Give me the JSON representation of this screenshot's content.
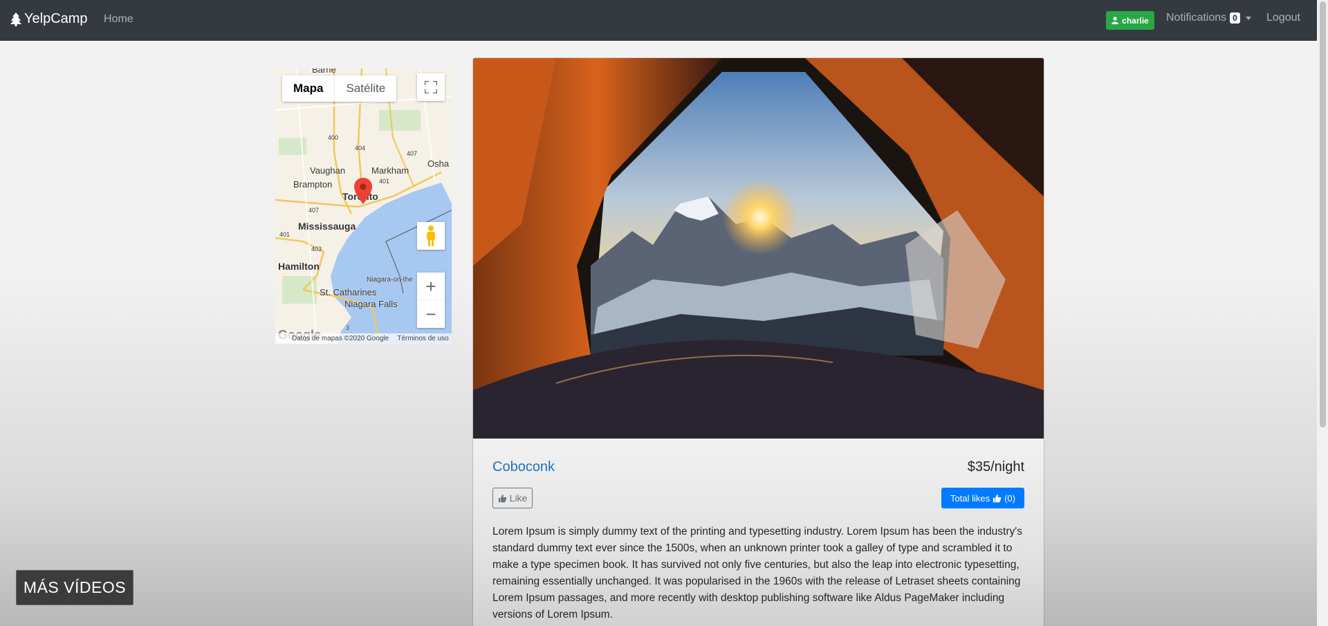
{
  "navbar": {
    "brand": "YelpCamp",
    "brand_icon": "tree-icon",
    "home": "Home",
    "user": "charlie",
    "user_icon": "user-icon",
    "notifications_label": "Notifications",
    "notifications_count": "0",
    "logout": "Logout"
  },
  "map": {
    "type_map": "Mapa",
    "type_satellite": "Satélite",
    "fullscreen_icon": "fullscreen-icon",
    "pegman_icon": "pegman-icon",
    "zoom_in": "+",
    "zoom_out": "−",
    "marker_icon": "map-marker-icon",
    "labels": {
      "barrie": "Barrie",
      "vaughan": "Vaughan",
      "markham": "Markham",
      "oshawa": "Osha",
      "brampton": "Brampton",
      "toronto": "Toronto",
      "mississauga": "Mississauga",
      "hamilton": "Hamilton",
      "niagara_on_the": "Niagara-on-the",
      "st_catharines": "St. Catharines",
      "niagara_falls": "Niagara Falls",
      "r400": "400",
      "r404": "404",
      "r407a": "407",
      "r401a": "401",
      "r407b": "407",
      "r401b": "401",
      "r403": "403",
      "r3": "3"
    },
    "google": "Google",
    "map_data": "Datos de mapas ©2020 Google",
    "terms": "Términos de uso"
  },
  "campground": {
    "name": "Coboconk",
    "price": "$35/night",
    "like_label": "Like",
    "total_likes_label": "Total likes",
    "total_likes_count": "(0)",
    "description": "Lorem Ipsum is simply dummy text of the printing and typesetting industry. Lorem Ipsum has been the industry's standard dummy text ever since the 1500s, when an unknown printer took a galley of type and scrambled it to make a type specimen book. It has survived not only five centuries, but also the leap into electronic typesetting, remaining essentially unchanged. It was popularised in the 1960s with the release of Letraset sheets containing Lorem Ipsum passages, and more recently with desktop publishing software like Aldus PageMaker including versions of Lorem Ipsum."
  },
  "overlay": {
    "more_videos": "MÁS VÍDEOS"
  },
  "colors": {
    "navbar": "#343a40",
    "success": "#28a745",
    "primary": "#007bff",
    "link": "#1e73be"
  }
}
